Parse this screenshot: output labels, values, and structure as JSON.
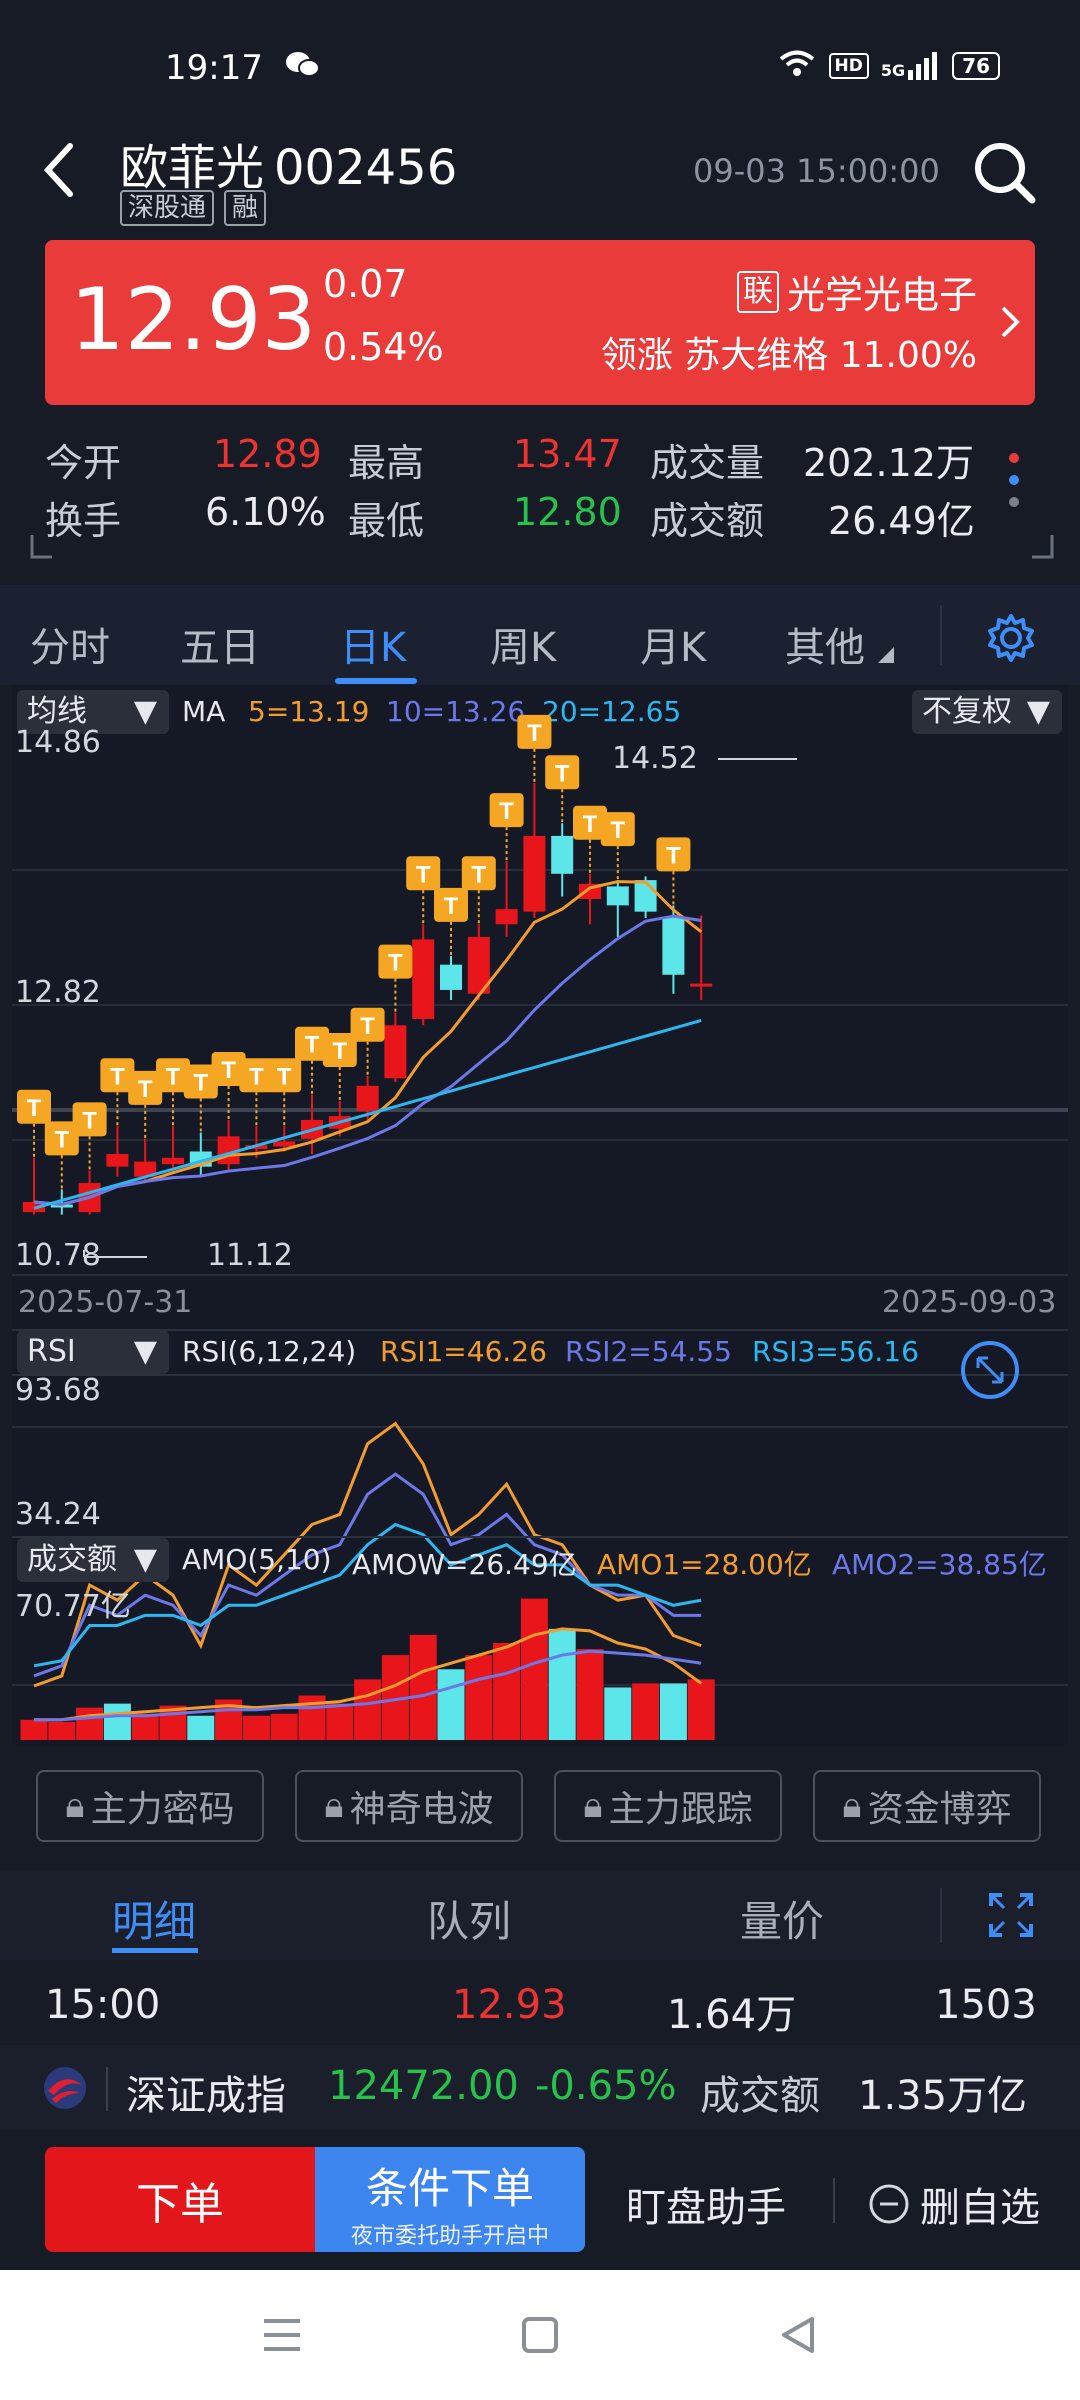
{
  "status": {
    "time": "19:17",
    "hd": "HD",
    "signal": "5G",
    "battery": "76"
  },
  "header": {
    "stock_name": "欧菲光",
    "code": "002456",
    "tags": [
      "深股通",
      "融"
    ],
    "datetime": "09-03 15:00:00"
  },
  "price": {
    "last": "12.93",
    "change": "0.07",
    "change_pct": "0.54%",
    "sector_tag": "联",
    "sector": "光学光电子",
    "leader": "领涨 苏大维格 11.00%"
  },
  "stats": [
    {
      "label": "今开",
      "value": "12.89",
      "color": "red"
    },
    {
      "label": "最高",
      "value": "13.47",
      "color": "red"
    },
    {
      "label": "成交量",
      "value": "202.12万",
      "color": "white"
    },
    {
      "label": "换手",
      "value": "6.10%",
      "color": "white"
    },
    {
      "label": "最低",
      "value": "12.80",
      "color": "green"
    },
    {
      "label": "成交额",
      "value": "26.49亿",
      "color": "white"
    }
  ],
  "tabs": [
    "分时",
    "五日",
    "日K",
    "周K",
    "月K",
    "其他"
  ],
  "active_tab": "日K",
  "kline": {
    "indicator": "均线",
    "fq": "不复权",
    "ma_label": "MA",
    "ma5": "5=13.19",
    "ma10": "10=13.26",
    "ma20": "20=12.65",
    "y_top": "14.86",
    "y_mid": "12.82",
    "y_bot": "10.78",
    "high_label": "14.52",
    "low_label": "11.12",
    "date_start": "2025-07-31",
    "date_end": "2025-09-03",
    "t_marker": "T",
    "colors": {
      "up": "#e8161a",
      "down": "#5ce6ea",
      "ma5": "#f39c2e",
      "ma10": "#6d78e8",
      "ma20": "#2db7f0"
    }
  },
  "rsi": {
    "indicator": "RSI",
    "params": "RSI(6,12,24)",
    "rsi1": "RSI1=46.26",
    "rsi2": "RSI2=54.55",
    "rsi3": "RSI3=56.16",
    "y_top": "93.68",
    "y_bot": "34.24"
  },
  "amo": {
    "indicator": "成交额",
    "params": "AMO(5,10)",
    "amow": "AMOW=26.49亿",
    "amo1": "AMO1=28.00亿",
    "amo2": "AMO2=38.85亿",
    "y_top": "70.77亿"
  },
  "tools": [
    "主力密码",
    "神奇电波",
    "主力跟踪",
    "资金博弈"
  ],
  "bottom_tabs": [
    "明细",
    "队列",
    "量价"
  ],
  "trade_row": {
    "time": "15:00",
    "price": "12.93",
    "volume": "1.64万",
    "count": "1503"
  },
  "index_row": {
    "name": "深证成指",
    "value": "12472.00",
    "change": "-0.65%",
    "amount_label": "成交额",
    "amount": "1.35万亿"
  },
  "actions": {
    "order": "下单",
    "cond_order": "条件下单",
    "cond_sub": "夜市委托助手开启中",
    "watch": "盯盘助手",
    "remove": "删自选"
  }
}
